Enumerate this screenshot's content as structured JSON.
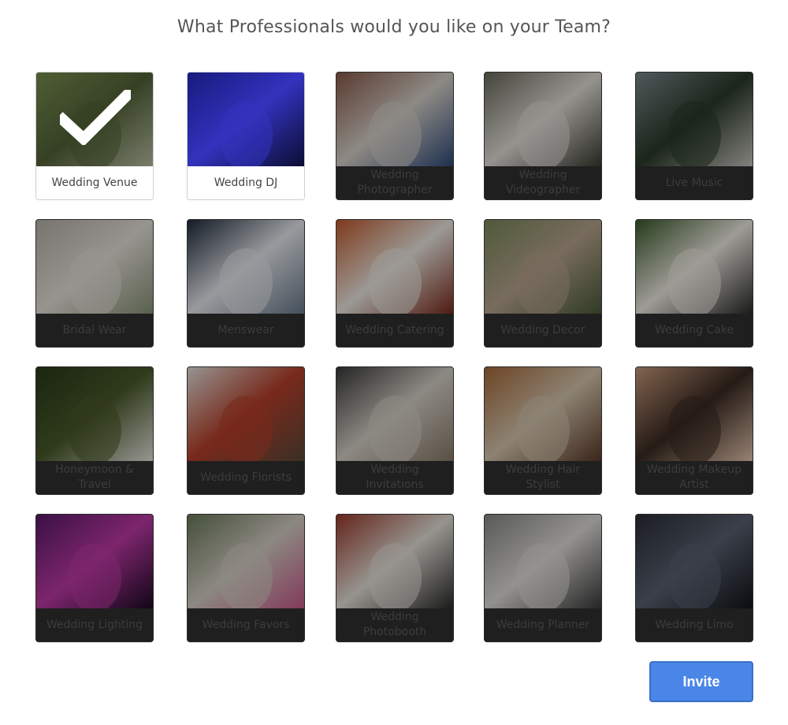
{
  "page": {
    "title": "What Professionals would you like on your Team?"
  },
  "cards": [
    {
      "label": "Wedding Venue",
      "selected": true,
      "colors": [
        "#5b6b3c",
        "#3e4a2a",
        "#8a8f7a"
      ]
    },
    {
      "label": "Wedding DJ",
      "selected": true,
      "colors": [
        "#1a1f8f",
        "#3a3ad8",
        "#0d0f3a"
      ]
    },
    {
      "label": "Wedding Photographer",
      "selected": false,
      "colors": [
        "#8b5a4a",
        "#d9d4cc",
        "#2e4a7a"
      ]
    },
    {
      "label": "Wedding Videographer",
      "selected": false,
      "colors": [
        "#6a6a5c",
        "#e6e2dc",
        "#3a3a32"
      ]
    },
    {
      "label": "Live Music",
      "selected": false,
      "colors": [
        "#7a8a8c",
        "#2a3a2a",
        "#c9c6c0"
      ]
    },
    {
      "label": "Bridal Wear",
      "selected": false,
      "colors": [
        "#b8b3aa",
        "#e8e4dc",
        "#8a9478"
      ]
    },
    {
      "label": "Menswear",
      "selected": false,
      "colors": [
        "#1e2a3a",
        "#e9ecf1",
        "#6a7a8c"
      ]
    },
    {
      "label": "Wedding Catering",
      "selected": false,
      "colors": [
        "#c25a2a",
        "#f0ece6",
        "#7a2a1a"
      ]
    },
    {
      "label": "Wedding Decor",
      "selected": false,
      "colors": [
        "#7a8a5c",
        "#b9a690",
        "#4a5a3a"
      ]
    },
    {
      "label": "Wedding Cake",
      "selected": false,
      "colors": [
        "#3a5a2a",
        "#f2efe6",
        "#2a2a2a"
      ]
    },
    {
      "label": "Honeymoon & Travel",
      "selected": false,
      "colors": [
        "#2a3a1a",
        "#4a5a2a",
        "#e8e8e0"
      ]
    },
    {
      "label": "Wedding Florists",
      "selected": false,
      "colors": [
        "#e6e3dd",
        "#b8402a",
        "#5a4a3a"
      ]
    },
    {
      "label": "Wedding Invitations",
      "selected": false,
      "colors": [
        "#3a3a3a",
        "#d8d4ca",
        "#8a7a6a"
      ]
    },
    {
      "label": "Wedding Hair Stylist",
      "selected": false,
      "colors": [
        "#a86a3a",
        "#d9c9b0",
        "#5a3a2a"
      ]
    },
    {
      "label": "Wedding Makeup Artist",
      "selected": false,
      "colors": [
        "#c89a7a",
        "#3a2a22",
        "#e8c8b0"
      ]
    },
    {
      "label": "Wedding Lighting",
      "selected": false,
      "colors": [
        "#5a1a6a",
        "#c03aa8",
        "#1a0a22"
      ]
    },
    {
      "label": "Wedding Favors",
      "selected": false,
      "colors": [
        "#6a7a5a",
        "#d8d2c8",
        "#c85a8a"
      ]
    },
    {
      "label": "Wedding Photobooth",
      "selected": false,
      "colors": [
        "#9a3a2a",
        "#e8e4dc",
        "#2a2a2a"
      ]
    },
    {
      "label": "Wedding Planner",
      "selected": false,
      "colors": [
        "#8a8a86",
        "#e2e0dc",
        "#3a3a3a"
      ]
    },
    {
      "label": "Wedding Limo",
      "selected": false,
      "colors": [
        "#2a2e36",
        "#5a6272",
        "#111418"
      ]
    }
  ],
  "actions": {
    "invite_label": "Invite"
  },
  "icons": {
    "selected_mark": "checkmark-icon"
  }
}
